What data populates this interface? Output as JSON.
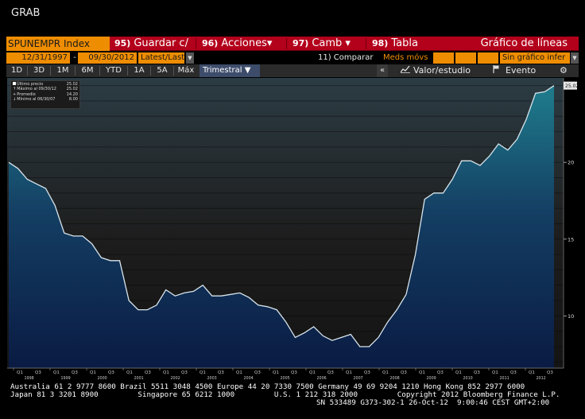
{
  "window": {
    "title": "GRAB"
  },
  "menu": {
    "ticker": "SPUNEMPR Index",
    "items": [
      {
        "num": "95)",
        "label": "Guardar c/"
      },
      {
        "num": "96)",
        "label": "Acciones▾"
      },
      {
        "num": "97)",
        "label": "Camb ▾"
      },
      {
        "num": "98)",
        "label": "Tabla"
      }
    ],
    "chart_type": "Gráfico de líneas"
  },
  "options": {
    "start_date": "12/31/1997",
    "dash": "-",
    "end_date": "09/30/2012",
    "price_mode": "Latest/Last",
    "compare": "11) Comparar",
    "moving_avg": "Meds móvs",
    "lower_chart": "Sin gráfico infer"
  },
  "tabs": {
    "periods": [
      "1D",
      "3D",
      "1M",
      "6M",
      "YTD",
      "1A",
      "5A",
      "Máx"
    ],
    "frequency": "Trimestral ▼",
    "collapse": "«",
    "value_study": "Valor/estudio",
    "event": "Evento",
    "gear": "⚙"
  },
  "legend": {
    "rows": [
      {
        "label": "Último precio",
        "value": "25.02"
      },
      {
        "label": "Máximo al 09/30/12",
        "value": "25.02"
      },
      {
        "label": "Promedio",
        "value": "14.20"
      },
      {
        "label": "Mínimo al 06/30/07",
        "value": "8.00"
      }
    ]
  },
  "chart_data": {
    "type": "area",
    "frequency": "quarterly",
    "series": [
      {
        "values": [
          20.0,
          19.6,
          18.9,
          18.6,
          18.3,
          17.2,
          15.4,
          15.2,
          15.2,
          14.7,
          13.8,
          13.6,
          13.6,
          11.0,
          10.4,
          10.4,
          10.7,
          11.7,
          11.3,
          11.5,
          11.6,
          12.0,
          11.3,
          11.3,
          11.4,
          11.5,
          11.2,
          10.7,
          10.6,
          10.4,
          9.6,
          8.6,
          8.9,
          9.3,
          8.7,
          8.4,
          8.6,
          8.8,
          8.0,
          8.0,
          8.6,
          9.6,
          10.4,
          11.4,
          14.0,
          17.6,
          18.0,
          18.0,
          18.9,
          20.1,
          20.1,
          19.8,
          20.4,
          21.2,
          20.8,
          21.5,
          22.8,
          24.5,
          24.6,
          25.0
        ]
      }
    ],
    "ylim": [
      6.6,
      25.5
    ],
    "yticks": [
      10,
      15,
      20
    ],
    "last_value_label": "25.02",
    "year_labels": [
      "1998",
      "1999",
      "2000",
      "2001",
      "2002",
      "2003",
      "2004",
      "2005",
      "2006",
      "2007",
      "2008",
      "2009",
      "2010",
      "2011",
      "2012"
    ],
    "quarter_labels": [
      "Q1",
      "Q3"
    ],
    "grid": true
  },
  "footer": {
    "line1": "Australia 61 2 9777 8600 Brazil 5511 3048 4500 Europe 44 20 7330 7500 Germany 49 69 9204 1210 Hong Kong 852 2977 6000",
    "line2": "Japan 81 3 3201 8900         Singapore 65 6212 1000         U.S. 1 212 318 2000         Copyright 2012 Bloomberg Finance L.P.",
    "line3": "SN 533489 G373-302-1 26-Oct-12  9:00:46 CEST GMT+2:00"
  },
  "colors": {
    "menu_red": "#b3001b",
    "orange": "#ef8d00",
    "area_top": "#1f7a8c",
    "area_bottom": "#0b1a3d",
    "line": "#d8e4ea"
  }
}
